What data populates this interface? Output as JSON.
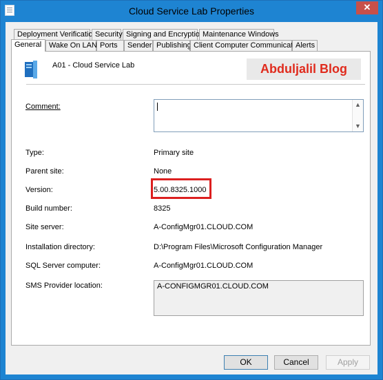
{
  "window": {
    "title": "Cloud Service Lab Properties",
    "close_glyph": "✕"
  },
  "tabs_row1": [
    "Deployment Verification",
    "Security",
    "Signing and Encryption",
    "Maintenance Windows"
  ],
  "tabs_row2": [
    "General",
    "Wake On LAN",
    "Ports",
    "Sender",
    "Publishing",
    "Client Computer Communication",
    "Alerts"
  ],
  "active_tab": "General",
  "site": {
    "name": "A01 - Cloud Service Lab"
  },
  "watermark": "Abduljalil Blog",
  "fields": {
    "comment_label": "Comment:",
    "comment_value": "",
    "type_label": "Type:",
    "type_value": "Primary site",
    "parent_label": "Parent site:",
    "parent_value": "None",
    "version_label": "Version:",
    "version_value": "5.00.8325.1000",
    "build_label": "Build number:",
    "build_value": "8325",
    "site_server_label": "Site server:",
    "site_server_value": "A-ConfigMgr01.CLOUD.COM",
    "install_label": "Installation directory:",
    "install_value": "D:\\Program Files\\Microsoft Configuration Manager",
    "sql_label": "SQL Server computer:",
    "sql_value": "A-ConfigMgr01.CLOUD.COM",
    "sms_label": "SMS Provider location:",
    "sms_value": "A-CONFIGMGR01.CLOUD.COM"
  },
  "buttons": {
    "ok": "OK",
    "cancel": "Cancel",
    "apply": "Apply"
  },
  "colors": {
    "titlebar": "#1e84d2",
    "highlight": "#dc1f1f",
    "watermark_text": "#e02b1d"
  }
}
